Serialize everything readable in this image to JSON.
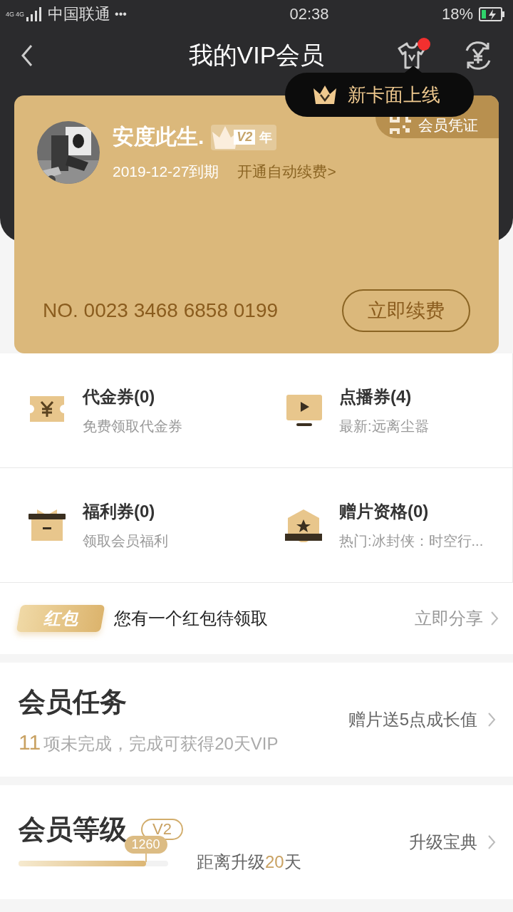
{
  "status_bar": {
    "network_labels": [
      "4G",
      "4G"
    ],
    "carrier": "中国联通",
    "more": "•••",
    "time": "02:38",
    "battery": "18%"
  },
  "header": {
    "title": "我的VIP会员",
    "skin_badge": true,
    "tooltip": "新卡面上线"
  },
  "card": {
    "user_name": "安度此生.",
    "level_badge": "V2",
    "level_period": "年",
    "expiry": "2019-12-27到期",
    "auto_renew_link": "开通自动续费>",
    "voucher": "会员凭证",
    "card_number": "NO. 0023 3468 6858 0199",
    "renew_button": "立即续费"
  },
  "benefits": [
    {
      "kind": "coupon",
      "title": "代金券(0)",
      "subtitle": "免费领取代金券"
    },
    {
      "kind": "video",
      "title": "点播券(4)",
      "subtitle": "最新:远离尘嚣"
    },
    {
      "kind": "gift",
      "title": "福利券(0)",
      "subtitle": "领取会员福利"
    },
    {
      "kind": "film",
      "title": "赠片资格(0)",
      "subtitle": "热门:冰封侠：时空行..."
    }
  ],
  "red_packet": {
    "badge": "红包",
    "text": "您有一个红包待领取",
    "action": "立即分享"
  },
  "tasks": {
    "title": "会员任务",
    "count": "11",
    "description": "项未完成，完成可获得20天VIP",
    "action": "赠片送5点成长值"
  },
  "level": {
    "title": "会员等级",
    "badge": "V2",
    "points": "1260",
    "level": 0.85,
    "remaining_prefix": "距离升级",
    "remaining_days": "20",
    "remaining_suffix": "天",
    "action": "升级宝典"
  }
}
